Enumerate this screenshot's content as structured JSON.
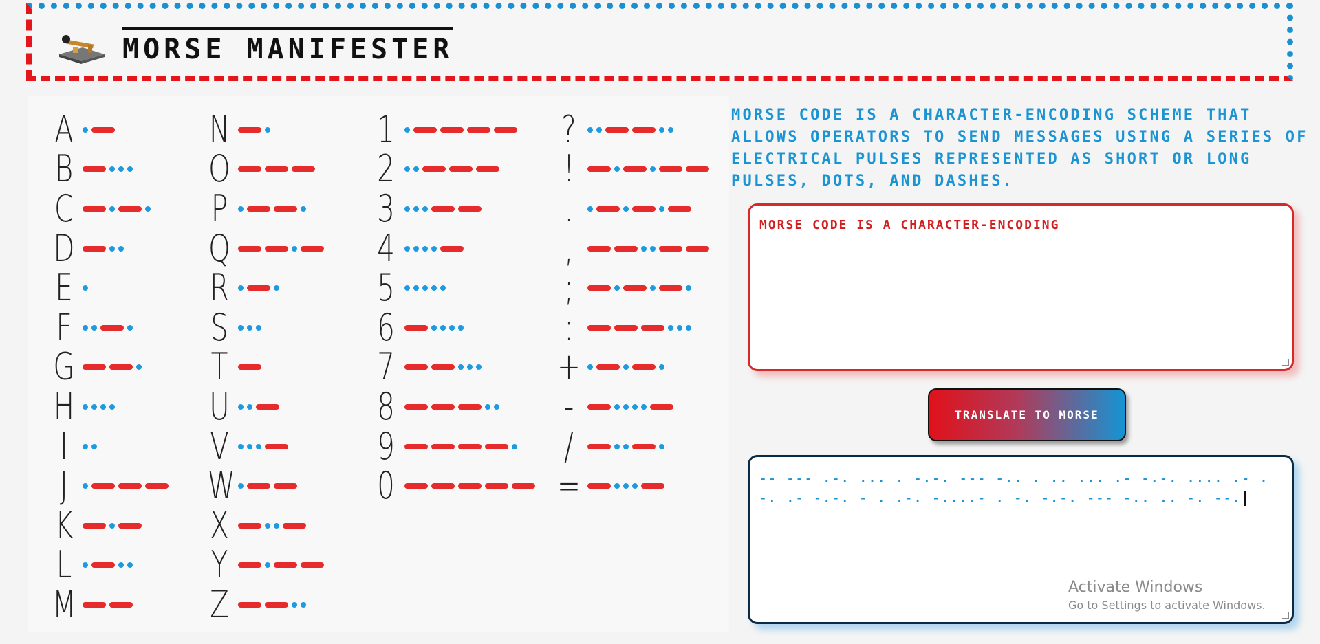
{
  "app": {
    "title": "MORSE MANIFESTER",
    "logo_icon": "telegraph-key-icon"
  },
  "colors": {
    "accent_red": "#e52b2b",
    "accent_blue": "#1e9ae0",
    "text_dark": "#111111"
  },
  "chart": {
    "columns": [
      [
        {
          "char": "A",
          "code": ".-"
        },
        {
          "char": "B",
          "code": "-..."
        },
        {
          "char": "C",
          "code": "-.-."
        },
        {
          "char": "D",
          "code": "-.."
        },
        {
          "char": "E",
          "code": "."
        },
        {
          "char": "F",
          "code": "..-."
        },
        {
          "char": "G",
          "code": "--."
        },
        {
          "char": "H",
          "code": "...."
        },
        {
          "char": "I",
          "code": ".."
        },
        {
          "char": "J",
          "code": ".---"
        },
        {
          "char": "K",
          "code": "-.-"
        },
        {
          "char": "L",
          "code": ".-.."
        },
        {
          "char": "M",
          "code": "--"
        }
      ],
      [
        {
          "char": "N",
          "code": "-."
        },
        {
          "char": "O",
          "code": "---"
        },
        {
          "char": "P",
          "code": ".--."
        },
        {
          "char": "Q",
          "code": "--.-"
        },
        {
          "char": "R",
          "code": ".-."
        },
        {
          "char": "S",
          "code": "..."
        },
        {
          "char": "T",
          "code": "-"
        },
        {
          "char": "U",
          "code": "..-"
        },
        {
          "char": "V",
          "code": "...-"
        },
        {
          "char": "W",
          "code": ".--"
        },
        {
          "char": "X",
          "code": "-..-"
        },
        {
          "char": "Y",
          "code": "-.--"
        },
        {
          "char": "Z",
          "code": "--.."
        }
      ],
      [
        {
          "char": "1",
          "code": ".----"
        },
        {
          "char": "2",
          "code": "..---"
        },
        {
          "char": "3",
          "code": "...--"
        },
        {
          "char": "4",
          "code": "....-"
        },
        {
          "char": "5",
          "code": "....."
        },
        {
          "char": "6",
          "code": "-...."
        },
        {
          "char": "7",
          "code": "--..."
        },
        {
          "char": "8",
          "code": "---.."
        },
        {
          "char": "9",
          "code": "----."
        },
        {
          "char": "0",
          "code": "-----"
        }
      ],
      [
        {
          "char": "?",
          "code": "..--.."
        },
        {
          "char": "!",
          "code": "-.-.--"
        },
        {
          "char": ".",
          "code": ".-.-.-"
        },
        {
          "char": ",",
          "code": "--..--"
        },
        {
          "char": ";",
          "code": "-.-.-."
        },
        {
          "char": ":",
          "code": "---..."
        },
        {
          "char": "+",
          "code": ".-.-."
        },
        {
          "char": "-",
          "code": "-....-"
        },
        {
          "char": "/",
          "code": "-..-."
        },
        {
          "char": "=",
          "code": "-...-"
        }
      ]
    ]
  },
  "description": "MORSE CODE IS A CHARACTER-ENCODING SCHEME THAT ALLOWS OPERATORS TO SEND MESSAGES USING A SERIES OF ELECTRICAL PULSES REPRESENTED AS SHORT OR LONG PULSES, DOTS, AND DASHES.",
  "input": {
    "value": "MORSE CODE IS A CHARACTER-ENCODING"
  },
  "translate_button": {
    "label": "TRANSLATE TO MORSE"
  },
  "output": {
    "value": "-- --- .-. ... .      -.-. --- -.. .      .. ...      .-      -.-. .... .- .-. .- -.-. - . .-. -....- . -. -.-. --- -.. .. -. --."
  },
  "watermark": {
    "line1": "Activate Windows",
    "line2": "Go to Settings to activate Windows."
  }
}
